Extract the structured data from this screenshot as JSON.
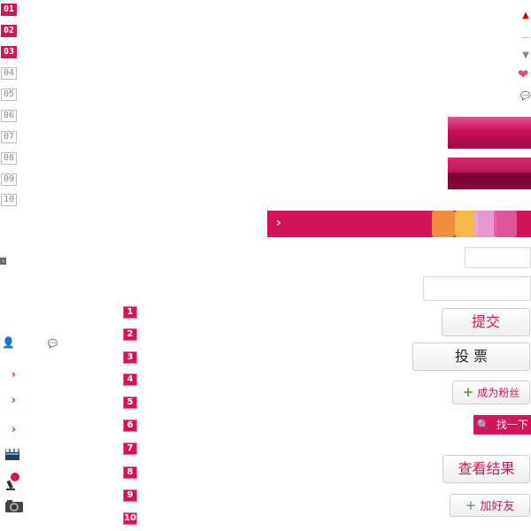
{
  "ranks_left": [
    "01",
    "02",
    "03",
    "04",
    "05",
    "06",
    "07",
    "08",
    "09",
    "10"
  ],
  "ranks_mid": [
    "1",
    "2",
    "3",
    "4",
    "5",
    "6",
    "7",
    "8",
    "9",
    "10"
  ],
  "buttons": {
    "submit": "提交",
    "vote": "投 票",
    "become_fan": "成为粉丝",
    "find": "找一下",
    "view_result": "查看结果",
    "add_friend": "加好友"
  },
  "icons": {
    "up": "▲",
    "minus": "—",
    "down": "▼",
    "heart": "❤",
    "comment": "💬",
    "person": "👤",
    "chevron": "›",
    "plus": "+",
    "search": "🔍"
  },
  "colors": {
    "brand": "#d4145a",
    "green_plus": "#6aa02c",
    "teal_plus": "#2a93b0"
  }
}
